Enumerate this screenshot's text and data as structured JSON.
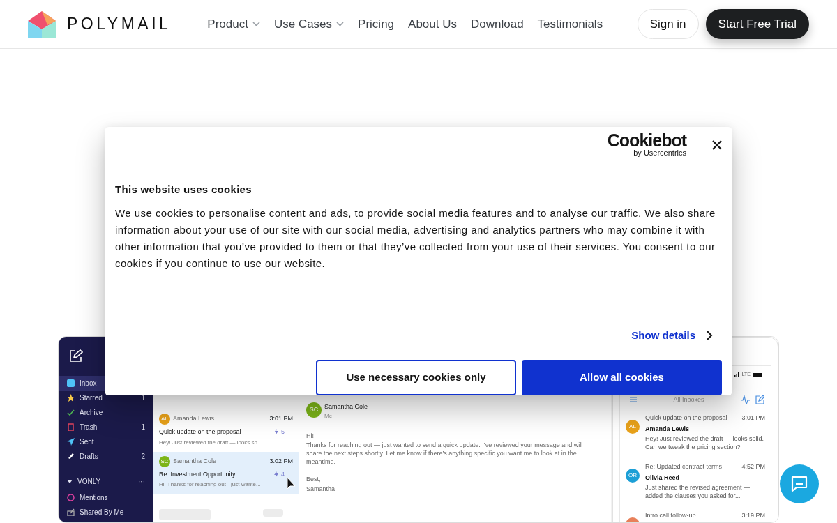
{
  "nav": {
    "brand": "POLYMAIL",
    "links": [
      {
        "label": "Product",
        "dropdown": true
      },
      {
        "label": "Use Cases",
        "dropdown": true
      },
      {
        "label": "Pricing",
        "dropdown": false
      },
      {
        "label": "About Us",
        "dropdown": false
      },
      {
        "label": "Download",
        "dropdown": false
      },
      {
        "label": "Testimonials",
        "dropdown": false
      }
    ],
    "sign_in": "Sign in",
    "cta": "Start Free Trial"
  },
  "cookie_dialog": {
    "brand": "Cookiebot",
    "brand_sub": "by Usercentrics",
    "title": "This website uses cookies",
    "body": "We use cookies to personalise content and ads, to provide social media features and to analyse our traffic. We also share information about your use of our site with our social media, advertising and analytics partners who may combine it with other information that you’ve provided to them or that they’ve collected from your use of their services. You consent to our cookies if you continue to use our website.",
    "details_link": "Show details",
    "buttons": [
      {
        "label": "Use necessary cookies only",
        "kind": "outline"
      },
      {
        "label": "Allow all cookies",
        "kind": "primary"
      }
    ]
  },
  "app_preview": {
    "sidebar": {
      "items": [
        {
          "label": "Inbox",
          "selected": true
        },
        {
          "label": "Starred",
          "count": "1",
          "selected": false
        },
        {
          "label": "Archive",
          "selected": false
        },
        {
          "label": "Trash",
          "count": "1",
          "selected": false
        },
        {
          "label": "Sent",
          "selected": false
        },
        {
          "label": "Drafts",
          "count": "2",
          "selected": false
        }
      ],
      "section": {
        "label": "VONLY",
        "expanded": true,
        "more": "···",
        "items": [
          {
            "label": "Mentions",
            "selected": false
          },
          {
            "label": "Shared By Me",
            "selected": false
          }
        ]
      }
    },
    "messages": [
      {
        "initials": "AL",
        "color": "#e9a21a",
        "sender": "Amanda Lewis",
        "time": "3:01 PM",
        "subject": "Quick update on the proposal",
        "thread_count": "5",
        "preview": "Hey! Just reviewed the draft — looks so...",
        "selected": false
      },
      {
        "initials": "SC",
        "color": "#7cb518",
        "sender": "Samantha Cole",
        "time": "3:02 PM",
        "subject": "Re: Investment Opportunity",
        "thread_count": "4",
        "preview": "Hi, Thanks for reaching out - just wante...",
        "selected": true
      }
    ],
    "email": {
      "initials": "SC",
      "color": "#7cb518",
      "sender": "Samantha Cole",
      "recipient": "Me",
      "greeting": "Hi!",
      "body": "Thanks for reaching out — just wanted to send a quick update. I’ve reviewed your message and will share the next steps shortly. Let me know if there’s anything specific you want me to look at in the meantime.",
      "signoff": "Best,",
      "signature": "Samantha"
    },
    "phone": {
      "network": "LTE",
      "title": "All Inboxes",
      "messages": [
        {
          "initials": "AL",
          "color": "#e9a21a",
          "subject": "Quick update on the proposal",
          "time": "3:01 PM",
          "sender": "Amanda Lewis",
          "preview": "Hey! Just reviewed the draft — looks solid. Can we tweak the pricing section?"
        },
        {
          "initials": "OR",
          "color": "#1c9fd6",
          "subject": "Re: Updated contract terms",
          "time": "4:52 PM",
          "sender": "Olivia Reed",
          "preview": "Just shared the revised agreement — added the clauses you asked for..."
        },
        {
          "color": "#e8805a",
          "subject": "Intro call follow-up",
          "time": "3:19 PM"
        }
      ]
    }
  }
}
